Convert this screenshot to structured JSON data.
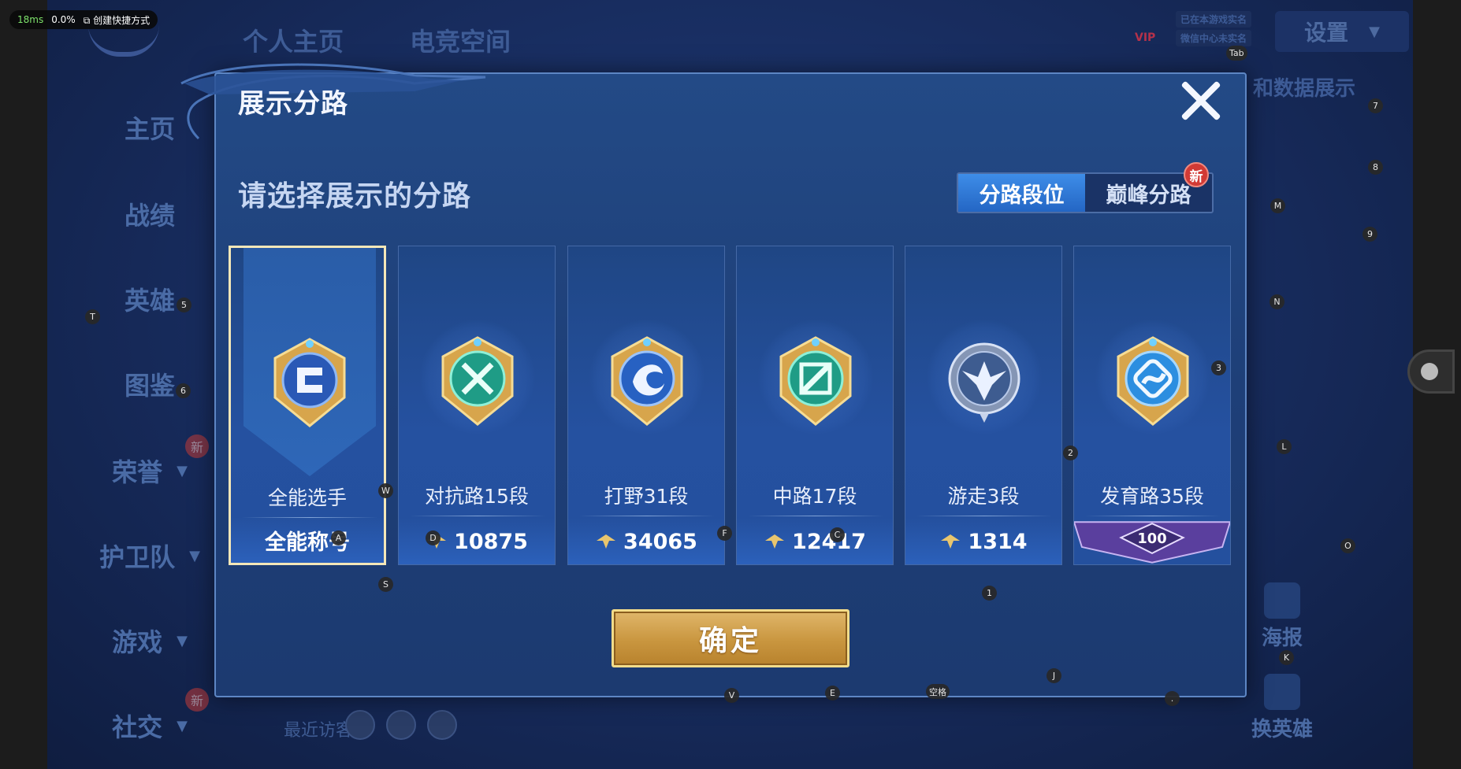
{
  "perf": {
    "latency": "18ms",
    "loss": "0.0%",
    "shortcut": "创建快捷方式"
  },
  "background": {
    "top_tabs": [
      "个人主页",
      "电竞空间"
    ],
    "sidebar": [
      "主页",
      "战绩",
      "英雄",
      "图鉴",
      "荣誉",
      "护卫队",
      "游戏",
      "社交"
    ],
    "sidebar_new_label": "新",
    "vip_label": "VIP",
    "realname_lines": [
      "已在本游戏实名",
      "微信中心未实名"
    ],
    "settings_label": "设置",
    "right_text": "和数据展示",
    "recent_visitors": "最近访客>",
    "side_buttons": [
      "海报",
      "换英雄"
    ]
  },
  "modal": {
    "title": "展示分路",
    "prompt": "请选择展示的分路",
    "segments": [
      "分路段位",
      "巅峰分路"
    ],
    "active_segment": 0,
    "new_badge": "新",
    "confirm_label": "确定",
    "cards": [
      {
        "name": "全能选手",
        "footer": "全能称号",
        "selected": true,
        "badge_icon": "all-round-emblem-icon"
      },
      {
        "name": "对抗路15段",
        "score": "10875",
        "selected": false,
        "badge_icon": "clash-lane-emblem-icon"
      },
      {
        "name": "打野31段",
        "score": "34065",
        "selected": false,
        "badge_icon": "jungle-emblem-icon"
      },
      {
        "name": "中路17段",
        "score": "12417",
        "selected": false,
        "badge_icon": "mid-lane-emblem-icon"
      },
      {
        "name": "游走3段",
        "score": "1314",
        "selected": false,
        "badge_icon": "roam-emblem-icon"
      },
      {
        "name": "发育路35段",
        "peak_value": "100",
        "selected": false,
        "badge_icon": "farm-lane-emblem-icon"
      }
    ]
  },
  "key_hints": [
    "Tab",
    "7",
    "8",
    "M",
    "9",
    "N",
    "3",
    "L",
    "2",
    "O",
    "K",
    "1",
    "J",
    "空格",
    "E",
    "V",
    "S",
    "F",
    "C",
    "D",
    "A",
    "W",
    "5",
    "T",
    "6",
    "."
  ],
  "colors": {
    "accent_blue": "#2f78d8",
    "gold": "#d8ac5a",
    "badge_red": "#d23a35",
    "selected_border": "#f4e7b8"
  }
}
